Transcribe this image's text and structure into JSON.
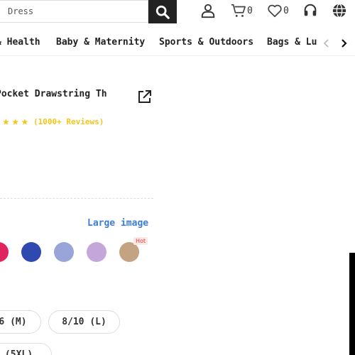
{
  "search": {
    "placeholder": "Dress"
  },
  "header": {
    "cart_count": "0",
    "wishlist_count": "0"
  },
  "categories": [
    "& Health",
    "Baby & Maternity",
    "Sports & Outdoors",
    "Bags & Lu"
  ],
  "product": {
    "title": "Pocket Drawstring Th",
    "rating_stars": 5,
    "reviews_label": "(1000+ Reviews)",
    "large_image_label": "Large image",
    "hot_badge": "Hot",
    "swatches": [
      "#e0245e",
      "#2f49b0",
      "#97a5d9",
      "#c5a6db",
      "#c4a383"
    ],
    "sizes": [
      "6 (M)",
      "8/10 (L)",
      "(5XL)"
    ]
  },
  "colors": {
    "accent_blue": "#3b7dd8",
    "star_yellow": "#f5c518",
    "search_button": "#222222"
  }
}
